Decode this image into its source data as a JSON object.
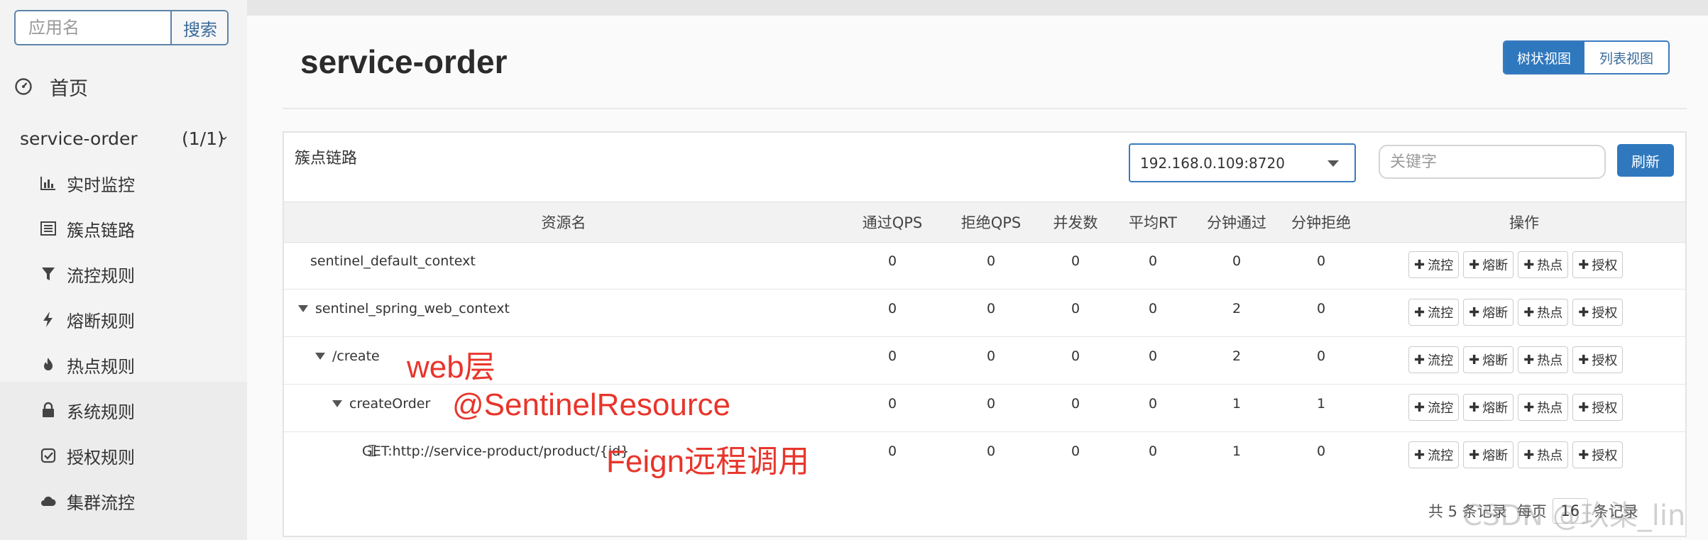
{
  "sidebar": {
    "search_placeholder": "应用名",
    "search_button": "搜索",
    "home": "首页",
    "app": {
      "name": "service-order",
      "count": "(1/1)"
    },
    "items": [
      {
        "label": "实时监控",
        "icon": "bar-chart-icon"
      },
      {
        "label": "簇点链路",
        "icon": "list-icon"
      },
      {
        "label": "流控规则",
        "icon": "filter-icon"
      },
      {
        "label": "熔断规则",
        "icon": "bolt-icon"
      },
      {
        "label": "热点规则",
        "icon": "fire-icon"
      },
      {
        "label": "系统规则",
        "icon": "lock-icon"
      },
      {
        "label": "授权规则",
        "icon": "check-icon"
      },
      {
        "label": "集群流控",
        "icon": "cloud-icon"
      }
    ]
  },
  "main": {
    "title": "service-order",
    "view_tree": "树状视图",
    "view_list": "列表视图",
    "panel_title": "簇点链路",
    "machine": "192.168.0.109:8720",
    "keyword_placeholder": "关键字",
    "refresh": "刷新",
    "columns": [
      "资源名",
      "通过QPS",
      "拒绝QPS",
      "并发数",
      "平均RT",
      "分钟通过",
      "分钟拒绝",
      "操作"
    ],
    "ops": [
      "流控",
      "熔断",
      "热点",
      "授权"
    ],
    "rows": [
      {
        "name": "sentinel_default_context",
        "level": 0,
        "expand": false,
        "values": [
          "0",
          "0",
          "0",
          "0",
          "0",
          "0"
        ]
      },
      {
        "name": "sentinel_spring_web_context",
        "level": 0,
        "expand": true,
        "values": [
          "0",
          "0",
          "0",
          "0",
          "2",
          "0"
        ]
      },
      {
        "name": "/create",
        "level": 1,
        "expand": true,
        "values": [
          "0",
          "0",
          "0",
          "0",
          "2",
          "0"
        ]
      },
      {
        "name": "createOrder",
        "level": 2,
        "expand": true,
        "values": [
          "0",
          "0",
          "0",
          "0",
          "1",
          "1"
        ]
      },
      {
        "name": "GET:http://service-product/product/{id}",
        "level": 3,
        "expand": false,
        "values": [
          "0",
          "0",
          "0",
          "0",
          "1",
          "0"
        ]
      }
    ],
    "pager": {
      "total": "共 5 条记录",
      "per_page": "每页",
      "size": "16",
      "suffix": "条记录"
    }
  },
  "annotations": [
    "web层",
    "@SentinelResource",
    "Feign远程调用"
  ],
  "watermark": "CSDN @玖柒_lin",
  "colors": {
    "primary": "#2f78be",
    "annotation": "#e8352b"
  }
}
